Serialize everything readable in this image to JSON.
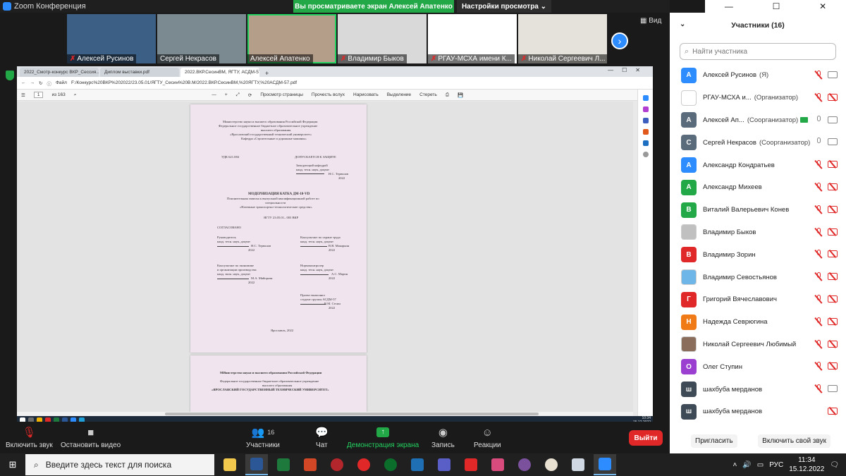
{
  "window": {
    "title": "Zoom Конференция"
  },
  "banner": {
    "sharing_text": "Вы просматриваете экран Алексей Апатенко",
    "view_options": "Настройки просмотра ⌄"
  },
  "window_controls": {
    "minimize": "—",
    "maximize": "☐",
    "close": "✕"
  },
  "video_strip": [
    {
      "name": "Алексей Русинов",
      "muted": true,
      "bg": "#3c5f86"
    },
    {
      "name": "Сергей Некрасов",
      "muted": false,
      "bg": "#7b8a90"
    },
    {
      "name": "Алексей Апатенко",
      "muted": false,
      "bg": "#b49d89",
      "active": true
    },
    {
      "name": "Владимир Быков",
      "muted": true,
      "bg": "#d9d9d9"
    },
    {
      "name": "РГАУ-МСХА имени К...",
      "muted": true,
      "bg": "#ffffff"
    },
    {
      "name": "Николай Сергеевич Л...",
      "muted": true,
      "bg": "#e5e2dc"
    }
  ],
  "view_button": "Вид",
  "browser": {
    "tabs": [
      "2022_Смотр-конкурс ВКР_Сессия...",
      "Диплом выставки.pdf",
      "2022.ВКР.СесинВМ, ЯГТУ, АСДМ-57..."
    ],
    "new_tab": "+",
    "file_label": "Файл",
    "url": "F:/Конкурс%20ВКР%202022/23.05.01/ЯГТУ_Сесин%20В.М/2022.ВКР.СесинВМ,%20ЯГТУ,%20АСДМ-57.pdf",
    "page_current": "1",
    "page_total": "из 163",
    "toolbar": {
      "minus": "—",
      "plus": "+",
      "page_view": "Просмотр страницы",
      "read_aloud": "Прочесть вслух",
      "draw": "Нарисовать",
      "highlight": "Выделение",
      "erase": "Стереть"
    }
  },
  "document": {
    "header1": "Министерство науки и высшего образования Российской Федерации",
    "header2": "Федеральное государственное бюджетное образовательное учреждение",
    "header3": "высшего образования",
    "header4": "«Ярославский государственный технический университет»",
    "header5": "Кафедра «Строительные и дорожные машины»",
    "udk": "УДК 621.084",
    "approve": "ДОПУСКАЕТСЯ К ЗАЩИТЕ",
    "head_of_dept": "Заведующий кафедрой",
    "head_degree": "канд. техн. наук, доцент",
    "head_name": "Н.С. Терюшов",
    "year_line": "2022",
    "title": "МОДЕРНИЗАЦИЯ КАТКА ДМ-10-VD",
    "subtitle1": "Пояснительная записка к выпускной квалификационной работе по",
    "subtitle2": "специальности",
    "subtitle3": "«Наземные транспортно-технологические средства»",
    "code": "ЯГТУ 23.05.01– 003 ВКР",
    "agreed": "СОГЛАСОВАНО",
    "supervisor": "Руководитель",
    "supervisor_deg": "канд. техн. наук, доцент",
    "supervisor_name": "Н.С. Терюшов",
    "safety": "Консультант по охране труда",
    "safety_deg": "канд. техн. наук, доцент",
    "safety_name": "В.В. Макарьин",
    "econ1": "Консультант по экономике",
    "econ2": "и организации производства",
    "econ_deg": "канд. экон. наук, доцент",
    "econ_name": "М.А. Майорова",
    "norm": "Нормоконтролер",
    "norm_deg": "канд. техн. наук, доцент",
    "norm_name": "А.С. Марин",
    "author1": "Проект выполнил",
    "author2": "студент группы АСДМ-57",
    "author_name": "В.М. Сесин",
    "city": "Ярославль, 2022",
    "p2_line1": "МИнистерство науки и высшего образования Российской Федерации",
    "p2_line2": "Федеральное государственное бюджетное образовательное учреждение",
    "p2_line3": "высшего образования",
    "p2_line4": "«ЯРОСЛАВСКИЙ ГОСУДАРСТВЕННЫЙ ТЕХНИЧЕСКИЙ УНИВЕРСИТЕТ»"
  },
  "inner_clock": {
    "time": "10:34",
    "date": "15.12.2022"
  },
  "controls": {
    "unmute": "Включить звук",
    "start_video": "Остановить видео",
    "participants": "Участники",
    "participants_count": "16",
    "chat": "Чат",
    "share": "Демонстрация экрана",
    "record": "Запись",
    "reactions": "Реакции",
    "leave": "Выйти"
  },
  "panel": {
    "title": "Участники (16)",
    "search_placeholder": "Найти участника",
    "participants": [
      {
        "initial": "А",
        "color": "#2d8cff",
        "name": "Алексей Русинов",
        "role": "(Я)",
        "mic": "muted",
        "cam": "on"
      },
      {
        "initial": "",
        "color": "#ffffff",
        "name": "РГАУ-МСХА и...",
        "role": "(Организатор)",
        "mic": "muted",
        "cam": "off",
        "photo": true
      },
      {
        "initial": "А",
        "color": "#5a6b7c",
        "name": "Алексей Ап...",
        "role": "(Соорганизатор)",
        "mic": "on",
        "cam": "on",
        "sharing": true
      },
      {
        "initial": "С",
        "color": "#5a6b7c",
        "name": "Сергей Некрасов",
        "role": "(Соорганизатор)",
        "mic": "on",
        "cam": "on"
      },
      {
        "initial": "А",
        "color": "#2d8cff",
        "name": "Александр Кондратьев",
        "role": "",
        "mic": "muted",
        "cam": "off"
      },
      {
        "initial": "А",
        "color": "#23a847",
        "name": "Александр Михеев",
        "role": "",
        "mic": "muted",
        "cam": "off"
      },
      {
        "initial": "В",
        "color": "#23a847",
        "name": "Виталий Валерьевич Конев",
        "role": "",
        "mic": "muted",
        "cam": "off"
      },
      {
        "initial": "",
        "color": "#c0c0c0",
        "name": "Владимир Быков",
        "role": "",
        "mic": "muted",
        "cam": "off",
        "photo": true
      },
      {
        "initial": "В",
        "color": "#e02828",
        "name": "Владимир Зорин",
        "role": "",
        "mic": "muted",
        "cam": "off"
      },
      {
        "initial": "",
        "color": "#6fb6e8",
        "name": "Владимир Севостьянов",
        "role": "",
        "mic": "muted",
        "cam": "off",
        "photo": true
      },
      {
        "initial": "Г",
        "color": "#e02828",
        "name": "Григорий Вячеславович",
        "role": "",
        "mic": "muted",
        "cam": "off"
      },
      {
        "initial": "Н",
        "color": "#f07b16",
        "name": "Надежда Севрюгина",
        "role": "",
        "mic": "muted",
        "cam": "off"
      },
      {
        "initial": "",
        "color": "#8a6d5a",
        "name": "Николай Сергеевич Любимый",
        "role": "",
        "mic": "muted",
        "cam": "off",
        "photo": true
      },
      {
        "initial": "О",
        "color": "#9b3fd1",
        "name": "Олег Ступин",
        "role": "",
        "mic": "muted",
        "cam": "off"
      },
      {
        "initial": "ш",
        "color": "#3e4a56",
        "name": "шахбуба мерданов",
        "role": "",
        "mic": "muted",
        "cam": "on"
      },
      {
        "initial": "ш",
        "color": "#3e4a56",
        "name": "шахбуба мерданов",
        "role": "",
        "mic": "none",
        "cam": "off"
      }
    ],
    "invite": "Пригласить",
    "unmute_self": "Включить свой звук"
  },
  "taskbar": {
    "search_placeholder": "Введите здесь текст для поиска",
    "lang": "РУС",
    "time": "11:34",
    "date": "15.12.2022"
  }
}
